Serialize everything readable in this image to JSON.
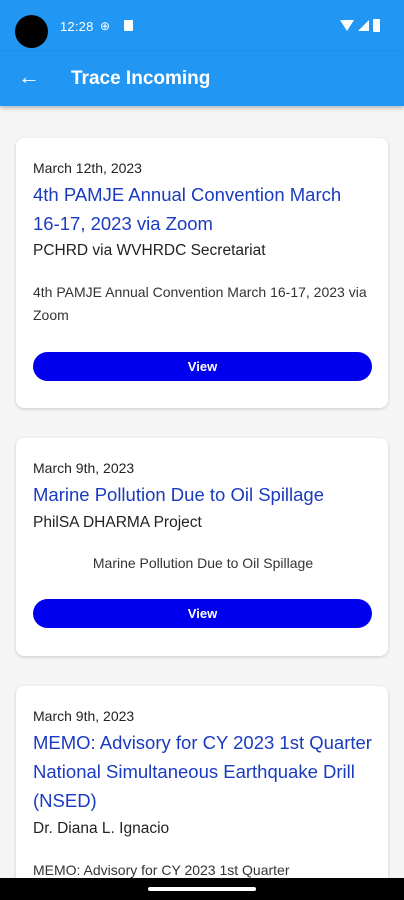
{
  "status_bar": {
    "time": "12:28",
    "globe_glyph": "⊕",
    "icons": [
      "wifi-icon",
      "signal-icon",
      "battery-icon"
    ]
  },
  "app_bar": {
    "back_glyph": "←",
    "title": "Trace Incoming"
  },
  "colors": {
    "app_bar": "#2196f3",
    "title_text": "#1a3bbf",
    "button": "#0000ee"
  },
  "cards": [
    {
      "date": "March 12th, 2023",
      "title": "4th PAMJE Annual Convention March 16-17, 2023 via Zoom",
      "sender": "PCHRD via WVHRDC Secretariat",
      "description": "4th PAMJE Annual Convention March 16-17, 2023 via Zoom",
      "button": "View"
    },
    {
      "date": "March 9th, 2023",
      "title": "Marine Pollution Due to Oil Spillage",
      "sender": "PhilSA DHARMA Project",
      "description": "Marine Pollution Due to Oil Spillage",
      "button": "View"
    },
    {
      "date": "March 9th, 2023",
      "title": "MEMO: Advisory for CY 2023 1st Quarter National Simultaneous Earthquake Drill (NSED)",
      "sender": "Dr. Diana L. Ignacio",
      "description": "MEMO: Advisory for CY 2023 1st Quarter"
    }
  ]
}
